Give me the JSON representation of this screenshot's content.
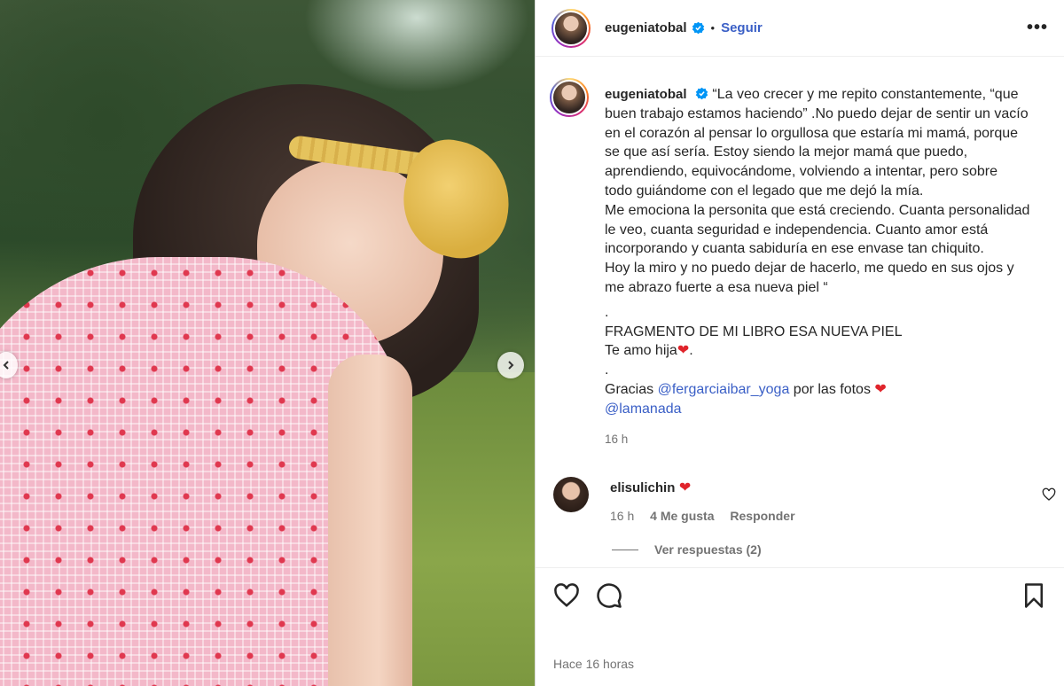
{
  "post": {
    "username": "eugeniatobal",
    "follow_label": "Seguir",
    "dot": "•",
    "more": "•••",
    "caption_lines": [
      "“La veo crecer y me repito constantemente, “que",
      "buen trabajo estamos haciendo” .No puedo dejar de sentir un vacío",
      "en el corazón al pensar lo orgullosa que estaría mi mamá, porque",
      "se que así sería. Estoy siendo la mejor mamá que puedo,",
      "aprendiendo, equivocándome, volviendo a intentar, pero sobre",
      "todo guiándome con el legado que me dejó la mía.",
      "Me emociona la personita que está creciendo. Cuanta personalidad",
      "le veo, cuanta seguridad e independencia. Cuanto amor está",
      "incorporando y cuanta sabiduría en ese envase tan chiquito.",
      "Hoy la miro y no puedo dejar de hacerlo, me quedo en sus ojos y",
      "me abrazo fuerte a esa nueva piel “",
      ".",
      "FRAGMENTO DE MI LIBRO ESA NUEVA PIEL",
      "Te amo hija",
      ".",
      "Gracias",
      "@fergarciaibar_yoga",
      "por las fotos",
      "@lamanada"
    ],
    "caption_time": "16 h",
    "time_ago": "Hace 16 horas"
  },
  "comment": {
    "username": "elisulichin",
    "time": "16 h",
    "likes": "4 Me gusta",
    "reply_label": "Responder",
    "view_replies": "Ver respuestas (2)"
  },
  "colors": {
    "accent": "#0095f6",
    "link": "#3a5fc6",
    "heart": "#e0242b",
    "muted": "#737373"
  },
  "icons": [
    "verified-badge-icon",
    "heart-icon",
    "comment-icon",
    "bookmark-icon",
    "chevron-left-icon",
    "chevron-right-icon",
    "more-icon",
    "heart-emoji-icon"
  ]
}
